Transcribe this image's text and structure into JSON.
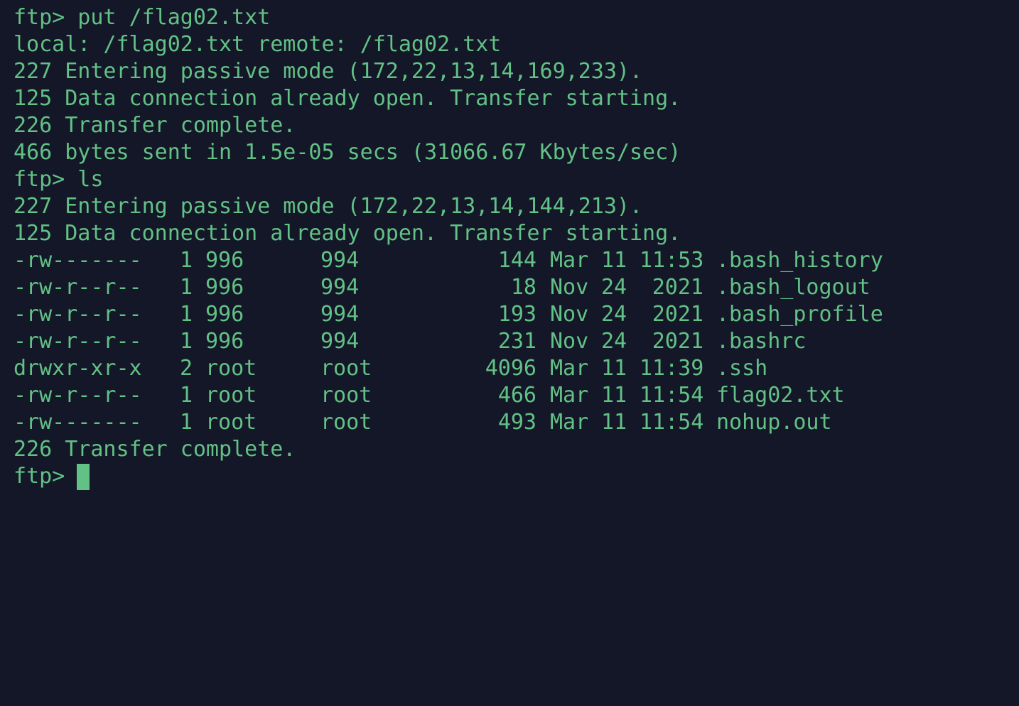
{
  "theme": {
    "background": "#141728",
    "foreground": "#62c185"
  },
  "output_lines_top": [
    "ftp> put /flag02.txt",
    "local: /flag02.txt remote: /flag02.txt",
    "227 Entering passive mode (172,22,13,14,169,233).",
    "125 Data connection already open. Transfer starting.",
    "226 Transfer complete.",
    "466 bytes sent in 1.5e-05 secs (31066.67 Kbytes/sec)",
    "ftp> ls",
    "227 Entering passive mode (172,22,13,14,144,213).",
    "125 Data connection already open. Transfer starting."
  ],
  "listing": [
    {
      "perm": "-rw-------",
      "links": "1",
      "owner": "996",
      "group": "994",
      "size": "144",
      "month": "Mar",
      "day": "11",
      "time": "11:53",
      "name": ".bash_history"
    },
    {
      "perm": "-rw-r--r--",
      "links": "1",
      "owner": "996",
      "group": "994",
      "size": "18",
      "month": "Nov",
      "day": "24",
      "time": "2021",
      "name": ".bash_logout"
    },
    {
      "perm": "-rw-r--r--",
      "links": "1",
      "owner": "996",
      "group": "994",
      "size": "193",
      "month": "Nov",
      "day": "24",
      "time": "2021",
      "name": ".bash_profile"
    },
    {
      "perm": "-rw-r--r--",
      "links": "1",
      "owner": "996",
      "group": "994",
      "size": "231",
      "month": "Nov",
      "day": "24",
      "time": "2021",
      "name": ".bashrc"
    },
    {
      "perm": "drwxr-xr-x",
      "links": "2",
      "owner": "root",
      "group": "root",
      "size": "4096",
      "month": "Mar",
      "day": "11",
      "time": "11:39",
      "name": ".ssh"
    },
    {
      "perm": "-rw-r--r--",
      "links": "1",
      "owner": "root",
      "group": "root",
      "size": "466",
      "month": "Mar",
      "day": "11",
      "time": "11:54",
      "name": "flag02.txt"
    },
    {
      "perm": "-rw-------",
      "links": "1",
      "owner": "root",
      "group": "root",
      "size": "493",
      "month": "Mar",
      "day": "11",
      "time": "11:54",
      "name": "nohup.out"
    }
  ],
  "output_lines_bottom": [
    "226 Transfer complete."
  ],
  "prompt": "ftp>"
}
